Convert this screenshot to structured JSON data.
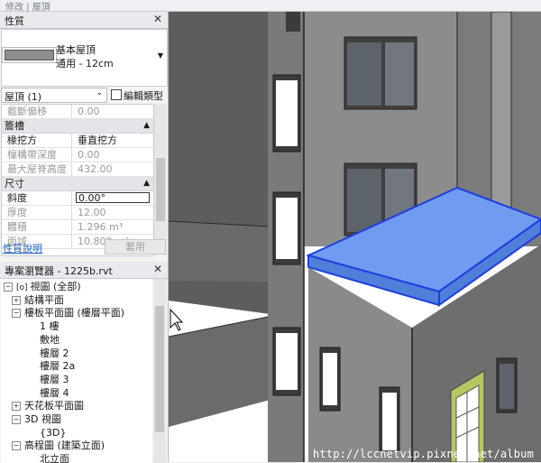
{
  "topbar": {
    "label": "修改 | 屋頂"
  },
  "properties": {
    "title": "性質",
    "close": "✕",
    "type_name": "基本屋頂",
    "type_sub": "通用 - 12cm",
    "instance_filter": "屋頂 (1)",
    "edit_type": "編輯類型",
    "rows": [
      {
        "kind": "row",
        "key": "截斷偏移",
        "value": "0.00",
        "dim": true
      },
      {
        "kind": "group",
        "key": "簷槽"
      },
      {
        "kind": "row",
        "key": "椽挖方",
        "value": "垂直挖方",
        "dim": false
      },
      {
        "kind": "row",
        "key": "檁構帶深度",
        "value": "0.00",
        "dim": true
      },
      {
        "kind": "row",
        "key": "最大屋脊高度",
        "value": "432.00",
        "dim": true
      },
      {
        "kind": "group",
        "key": "尺寸"
      },
      {
        "kind": "row",
        "key": "斜度",
        "value": "0.00°",
        "dim": false,
        "boxed": true
      },
      {
        "kind": "row",
        "key": "厚度",
        "value": "12.00",
        "dim": true
      },
      {
        "kind": "row",
        "key": "體積",
        "value": "1.296 m³",
        "dim": true
      },
      {
        "kind": "row",
        "key": "面域",
        "value": "10.800 m²",
        "dim": true
      }
    ],
    "help_link": "性質說明",
    "apply": "套用"
  },
  "browser": {
    "title": "專案瀏覽器 - 1225b.rvt",
    "close": "✕",
    "nodes": [
      {
        "text": "視圖 (全部)",
        "pm": "−",
        "indent": 0,
        "icon": "[o]"
      },
      {
        "text": "結構平面",
        "pm": "+",
        "indent": 1
      },
      {
        "text": "樓板平面圖 (樓層平面)",
        "pm": "−",
        "indent": 1
      },
      {
        "text": "1 樓",
        "indent": 3
      },
      {
        "text": "敷地",
        "indent": 3
      },
      {
        "text": "樓層 2",
        "indent": 3
      },
      {
        "text": "樓層 2a",
        "indent": 3
      },
      {
        "text": "樓層 3",
        "indent": 3
      },
      {
        "text": "樓層 4",
        "indent": 3
      },
      {
        "text": "天花板平面圖",
        "pm": "+",
        "indent": 1
      },
      {
        "text": "3D 視圖",
        "pm": "−",
        "indent": 1
      },
      {
        "text": "{3D}",
        "indent": 3
      },
      {
        "text": "高程圖 (建築立面)",
        "pm": "−",
        "indent": 1
      },
      {
        "text": "北立面",
        "indent": 3
      }
    ]
  },
  "watermark": "http://lccnetvip.pixnet.net/album",
  "colors": {
    "roof_fill": "#6f9cf0",
    "roof_edge": "#1f3fe0",
    "wall": "#8a8a8a",
    "door": "#b9c463"
  }
}
